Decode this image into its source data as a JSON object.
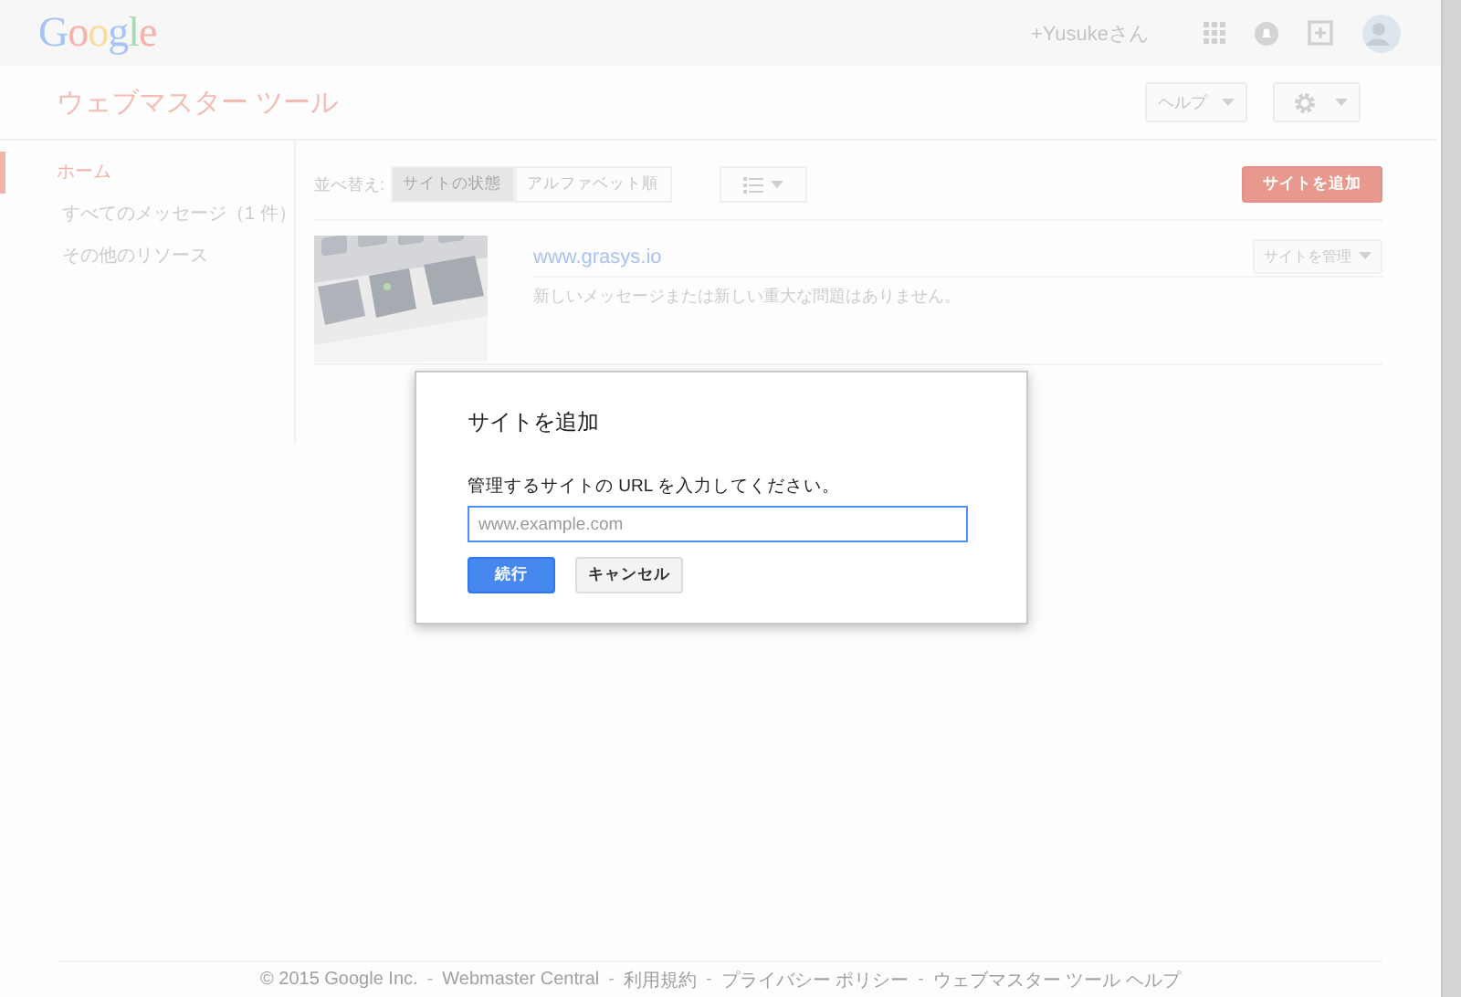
{
  "header": {
    "logo": "Google",
    "user": "+Yusukeさん"
  },
  "title_bar": {
    "title": "ウェブマスター ツール",
    "help_button": "ヘルプ"
  },
  "sidebar": {
    "items": [
      {
        "label": "ホーム",
        "selected": true
      },
      {
        "label": "すべてのメッセージ（1 件）",
        "selected": false
      },
      {
        "label": "その他のリソース",
        "selected": false
      }
    ]
  },
  "toolbar": {
    "sort_label": "並べ替え:",
    "sort_options": [
      {
        "label": "サイトの状態",
        "selected": true
      },
      {
        "label": "アルファベット順",
        "selected": false
      }
    ],
    "add_button": "サイトを追加"
  },
  "sites": [
    {
      "url": "www.grasys.io",
      "manage_button": "サイトを管理",
      "message": "新しいメッセージまたは新しい重大な問題はありません。"
    }
  ],
  "dialog": {
    "title": "サイトを追加",
    "prompt": "管理するサイトの URL を入力してください。",
    "placeholder": "www.example.com",
    "buttons": [
      {
        "label": "続行",
        "kind": "primary"
      },
      {
        "label": "キャンセル",
        "kind": "secondary"
      }
    ]
  },
  "footer": [
    {
      "text": "© 2015 Google Inc.",
      "kind": "link"
    },
    {
      "text": "-",
      "kind": "separator"
    },
    {
      "text": "Webmaster Central",
      "kind": "link"
    },
    {
      "text": "-",
      "kind": "separator"
    },
    {
      "text": "利用規約",
      "kind": "link"
    },
    {
      "text": "-",
      "kind": "separator"
    },
    {
      "text": "プライバシー ポリシー",
      "kind": "link"
    },
    {
      "text": "-",
      "kind": "separator"
    },
    {
      "text": "ウェブマスター ツール ヘルプ",
      "kind": "link"
    }
  ]
}
